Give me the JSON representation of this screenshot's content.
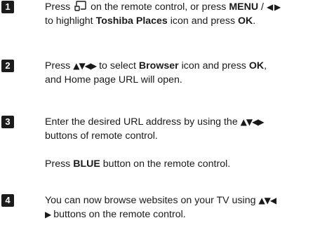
{
  "steps": [
    {
      "number": "1",
      "line1_a": "Press",
      "home_icon": "home-icon",
      "line1_b": "on the remote control, or press",
      "line1_menu": "MENU",
      "line1_sep": " / ",
      "line1_arrows": "◀ ▶",
      "line2_a": "to highlight",
      "line2_places": "Toshiba Places",
      "line2_b": "icon and press",
      "line2_ok": "OK",
      "line2_end": "."
    },
    {
      "number": "2",
      "line1_a": "Press",
      "line1_arrows": "▲▼◀▶",
      "line1_b": "to select",
      "line1_browser": "Browser",
      "line1_c": "icon and press",
      "line1_ok": "OK",
      "line1_end": ",",
      "line2": "and Home page URL will open."
    },
    {
      "number": "3",
      "line1_a": "Enter the desired URL address by using the",
      "line1_arrows": "▲▼◀▶",
      "line2": "buttons of remote control.",
      "line3_a": "Press",
      "line3_blue": "BLUE",
      "line3_b": "button on the remote control."
    },
    {
      "number": "4",
      "line1_a": "You can now browse websites on your TV using",
      "line1_arrows": "▲▼◀",
      "line2_arrow": "▶",
      "line2_b": "buttons on the remote control."
    }
  ]
}
